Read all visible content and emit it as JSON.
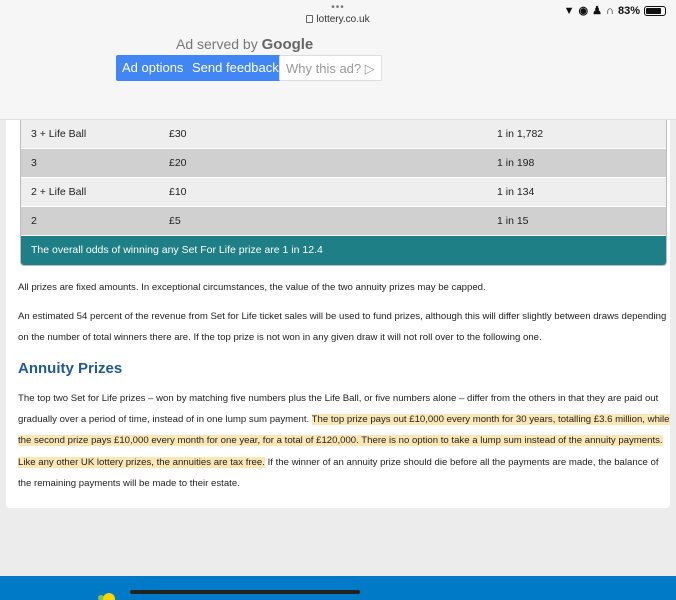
{
  "status": {
    "dots": "•••",
    "url": "lottery.co.uk",
    "battery": "83%",
    "battery_level": 0.83
  },
  "ad": {
    "served_prefix": "Ad served by",
    "served_brand": "Google",
    "options_label": "Ad options",
    "feedback_label": "Send feedback",
    "why_label": "Why this ad?"
  },
  "prize_table": {
    "rows": [
      {
        "match": "3 + Life Ball",
        "prize": "£30",
        "odds": "1 in 1,782"
      },
      {
        "match": "3",
        "prize": "£20",
        "odds": "1 in 198"
      },
      {
        "match": "2 + Life Ball",
        "prize": "£10",
        "odds": "1 in 134"
      },
      {
        "match": "2",
        "prize": "£5",
        "odds": "1 in 15"
      }
    ],
    "overall_odds": "The overall odds of winning any Set For Life prize are 1 in 12.4"
  },
  "content": {
    "para1": "All prizes are fixed amounts. In exceptional circumstances, the value of the two annuity prizes may be capped.",
    "para2": "An estimated 54 percent of the revenue from Set for Life ticket sales will be used to fund prizes, although this will differ slightly between draws depending on the number of total winners there are. If the top prize is not won in any given draw it will not roll over to the following one.",
    "heading": "Annuity Prizes",
    "para3_plain": "The top two Set for Life prizes – won by matching five numbers plus the Life Ball, or five numbers alone – differ from the others in that they are paid out gradually over a period of time, instead of in one lump sum payment. ",
    "para3_highlight": "The top prize pays out £10,000 every month for 30 years, totalling £3.6 million, while the second prize pays £10,000 every month for one year, for a total of £120,000. There is no option to take a lump sum instead of the annuity payments.",
    "para4_highlight": "Like any other UK lottery prizes, the annuities are tax free.",
    "para4_plain": " If the winner of an annuity prize should die before all the payments are made, the balance of the remaining payments will be made to their estate."
  }
}
